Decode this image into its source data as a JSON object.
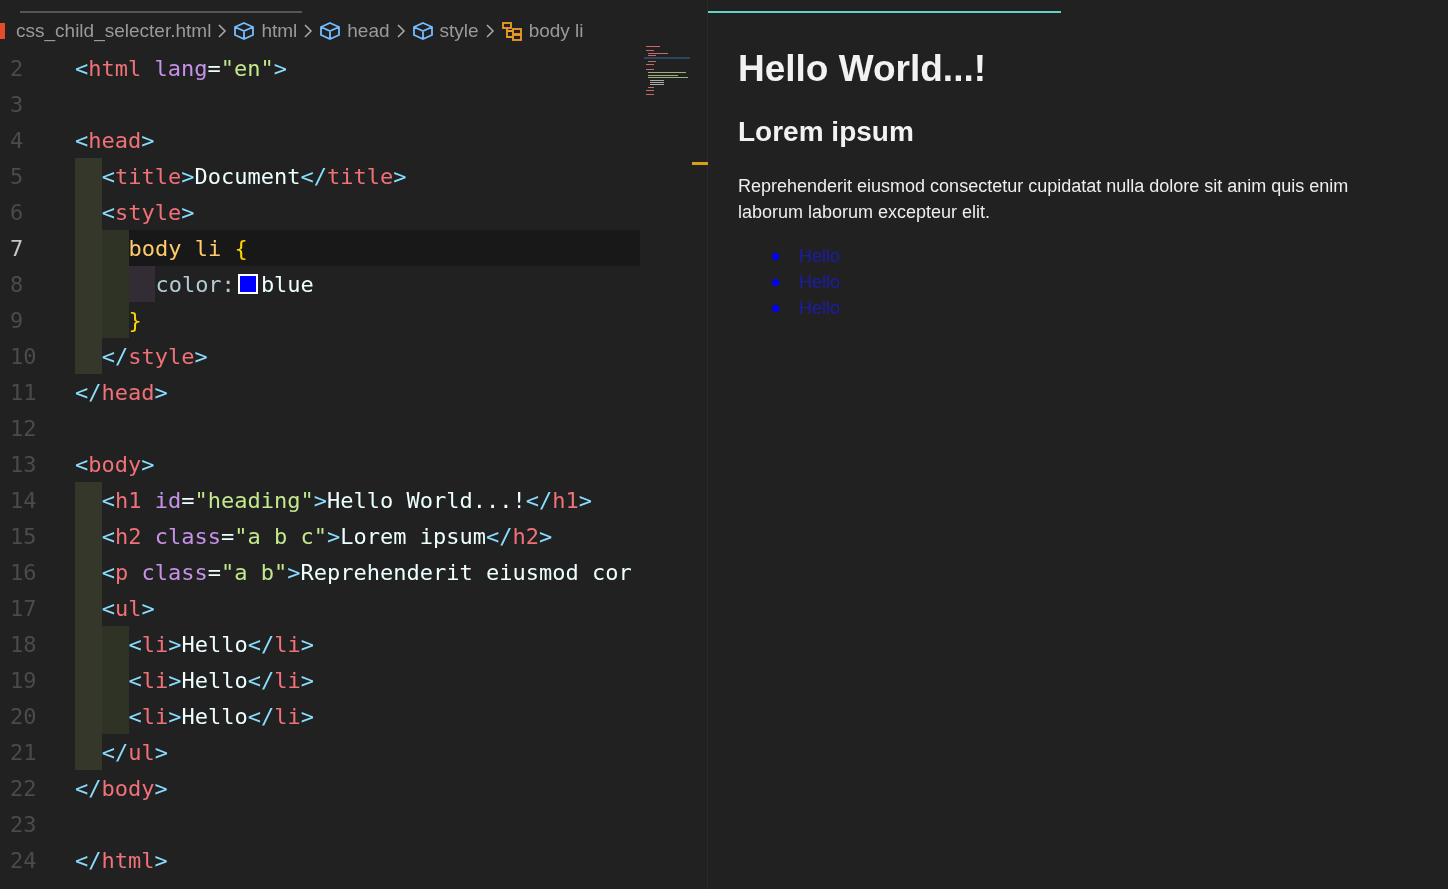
{
  "breadcrumb": [
    {
      "label": "css_child_selecter.html",
      "kind": "file"
    },
    {
      "label": "html",
      "kind": "element"
    },
    {
      "label": "head",
      "kind": "element"
    },
    {
      "label": "style",
      "kind": "element"
    },
    {
      "label": "body li",
      "kind": "selector"
    }
  ],
  "code_lines": [
    {
      "number": "2",
      "current": false,
      "tokens": [
        {
          "text": "<",
          "kind": "bracket"
        },
        {
          "text": "html",
          "kind": "tag"
        },
        {
          "text": " lang",
          "kind": "attr"
        },
        {
          "text": "=",
          "kind": "plain"
        },
        {
          "text": "\"en\"",
          "kind": "string"
        },
        {
          "text": ">",
          "kind": "bracket"
        }
      ]
    },
    {
      "number": "3",
      "current": false
    },
    {
      "number": "4",
      "current": false,
      "tokens": [
        {
          "text": "<",
          "kind": "bracket"
        },
        {
          "text": "head",
          "kind": "tag"
        },
        {
          "text": ">",
          "kind": "bracket"
        }
      ],
      "children": [
        {
          "number": "5",
          "current": false,
          "tokens": [
            {
              "text": "<",
              "kind": "bracket"
            },
            {
              "text": "title",
              "kind": "tag"
            },
            {
              "text": ">",
              "kind": "bracket"
            },
            {
              "text": "Document",
              "kind": "plain"
            },
            {
              "text": "</",
              "kind": "bracket"
            },
            {
              "text": "title",
              "kind": "tag"
            },
            {
              "text": ">",
              "kind": "bracket"
            }
          ]
        },
        {
          "number": "6",
          "current": false,
          "tokens": [
            {
              "text": "<",
              "kind": "bracket"
            },
            {
              "text": "style",
              "kind": "tag"
            },
            {
              "text": ">",
              "kind": "bracket"
            }
          ],
          "children": [
            {
              "number": "7",
              "current": true,
              "tokens": [
                {
                  "text": "body li",
                  "kind": "selector"
                },
                {
                  "text": " {",
                  "kind": "brace"
                }
              ],
              "children": [
                {
                  "number": "8",
                  "current": false,
                  "tokens": [
                    {
                      "text": "color:",
                      "kind": "property"
                    },
                    {
                      "kind": "swatch",
                      "color": "#0000ff"
                    },
                    {
                      "text": "blue",
                      "kind": "plain"
                    }
                  ]
                }
              ]
            },
            {
              "number": "9",
              "current": false,
              "tokens": [
                {
                  "text": "}",
                  "kind": "brace"
                }
              ]
            }
          ]
        },
        {
          "number": "10",
          "current": false,
          "tokens": [
            {
              "text": "</",
              "kind": "bracket"
            },
            {
              "text": "style",
              "kind": "tag"
            },
            {
              "text": ">",
              "kind": "bracket"
            }
          ]
        }
      ]
    },
    {
      "number": "11",
      "current": false,
      "tokens": [
        {
          "text": "</",
          "kind": "bracket"
        },
        {
          "text": "head",
          "kind": "tag"
        },
        {
          "text": ">",
          "kind": "bracket"
        }
      ]
    },
    {
      "number": "12",
      "current": false
    },
    {
      "number": "13",
      "current": false,
      "tokens": [
        {
          "text": "<",
          "kind": "bracket"
        },
        {
          "text": "body",
          "kind": "tag"
        },
        {
          "text": ">",
          "kind": "bracket"
        }
      ],
      "children": [
        {
          "number": "14",
          "current": false,
          "tokens": [
            {
              "text": "<",
              "kind": "bracket"
            },
            {
              "text": "h1",
              "kind": "tag"
            },
            {
              "text": " id",
              "kind": "attr"
            },
            {
              "text": "=",
              "kind": "plain"
            },
            {
              "text": "\"heading\"",
              "kind": "string"
            },
            {
              "text": ">",
              "kind": "bracket"
            },
            {
              "text": "Hello World...!",
              "kind": "plain"
            },
            {
              "text": "</",
              "kind": "bracket"
            },
            {
              "text": "h1",
              "kind": "tag"
            },
            {
              "text": ">",
              "kind": "bracket"
            }
          ]
        },
        {
          "number": "15",
          "current": false,
          "tokens": [
            {
              "text": "<",
              "kind": "bracket"
            },
            {
              "text": "h2",
              "kind": "tag"
            },
            {
              "text": " class",
              "kind": "attr"
            },
            {
              "text": "=",
              "kind": "plain"
            },
            {
              "text": "\"a b c\"",
              "kind": "string"
            },
            {
              "text": ">",
              "kind": "bracket"
            },
            {
              "text": "Lorem ipsum",
              "kind": "plain"
            },
            {
              "text": "</",
              "kind": "bracket"
            },
            {
              "text": "h2",
              "kind": "tag"
            },
            {
              "text": ">",
              "kind": "bracket"
            }
          ]
        },
        {
          "number": "16",
          "current": false,
          "tokens": [
            {
              "text": "<",
              "kind": "bracket"
            },
            {
              "text": "p",
              "kind": "tag"
            },
            {
              "text": " class",
              "kind": "attr"
            },
            {
              "text": "=",
              "kind": "plain"
            },
            {
              "text": "\"a b\"",
              "kind": "string"
            },
            {
              "text": ">",
              "kind": "bracket"
            },
            {
              "text": "Reprehenderit eiusmod cor",
              "kind": "plain"
            }
          ]
        },
        {
          "number": "17",
          "current": false,
          "tokens": [
            {
              "text": "<",
              "kind": "bracket"
            },
            {
              "text": "ul",
              "kind": "tag"
            },
            {
              "text": ">",
              "kind": "bracket"
            }
          ],
          "children": [
            {
              "number": "18",
              "current": false,
              "tokens": [
                {
                  "text": "<",
                  "kind": "bracket"
                },
                {
                  "text": "li",
                  "kind": "tag"
                },
                {
                  "text": ">",
                  "kind": "bracket"
                },
                {
                  "text": "Hello",
                  "kind": "plain"
                },
                {
                  "text": "</",
                  "kind": "bracket"
                },
                {
                  "text": "li",
                  "kind": "tag"
                },
                {
                  "text": ">",
                  "kind": "bracket"
                }
              ]
            },
            {
              "number": "19",
              "current": false,
              "tokens": [
                {
                  "text": "<",
                  "kind": "bracket"
                },
                {
                  "text": "li",
                  "kind": "tag"
                },
                {
                  "text": ">",
                  "kind": "bracket"
                },
                {
                  "text": "Hello",
                  "kind": "plain"
                },
                {
                  "text": "</",
                  "kind": "bracket"
                },
                {
                  "text": "li",
                  "kind": "tag"
                },
                {
                  "text": ">",
                  "kind": "bracket"
                }
              ]
            },
            {
              "number": "20",
              "current": false,
              "tokens": [
                {
                  "text": "<",
                  "kind": "bracket"
                },
                {
                  "text": "li",
                  "kind": "tag"
                },
                {
                  "text": ">",
                  "kind": "bracket"
                },
                {
                  "text": "Hello",
                  "kind": "plain"
                },
                {
                  "text": "</",
                  "kind": "bracket"
                },
                {
                  "text": "li",
                  "kind": "tag"
                },
                {
                  "text": ">",
                  "kind": "bracket"
                }
              ]
            }
          ]
        },
        {
          "number": "21",
          "current": false,
          "tokens": [
            {
              "text": "</",
              "kind": "bracket"
            },
            {
              "text": "ul",
              "kind": "tag"
            },
            {
              "text": ">",
              "kind": "bracket"
            }
          ]
        }
      ]
    },
    {
      "number": "22",
      "current": false,
      "tokens": [
        {
          "text": "</",
          "kind": "bracket"
        },
        {
          "text": "body",
          "kind": "tag"
        },
        {
          "text": ">",
          "kind": "bracket"
        }
      ]
    },
    {
      "number": "23",
      "current": false
    },
    {
      "number": "24",
      "current": false,
      "tokens": [
        {
          "text": "</",
          "kind": "bracket"
        },
        {
          "text": "html",
          "kind": "tag"
        },
        {
          "text": ">",
          "kind": "bracket"
        }
      ]
    }
  ],
  "preview": {
    "heading": "Hello World...!",
    "subheading": "Lorem ipsum",
    "paragraph": "Reprehenderit eiusmod consectetur cupidatat nulla dolore sit anim quis enim laborum laborum excepteur elit.",
    "list_items": [
      "Hello",
      "Hello",
      "Hello"
    ]
  }
}
